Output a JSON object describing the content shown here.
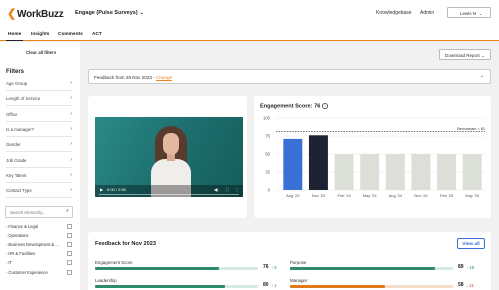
{
  "header": {
    "logo_text": "WorkBuzz",
    "product": "Engage (Pulse Surveys)",
    "links": [
      "Knowledgebase",
      "Admin"
    ],
    "user": "Lewis N"
  },
  "tabs": [
    "Home",
    "Insights",
    "Comments",
    "ACT"
  ],
  "active_tab": "Home",
  "accent_color": "#e8841a",
  "sidebar": {
    "clear_label": "Clear all filters",
    "title": "Filters",
    "filters": [
      "Age Group",
      "Length of Service",
      "Office",
      "Is a manager?",
      "Gender",
      "Job Grade",
      "Key Talent",
      "Contact Type"
    ],
    "search_placeholder": "Search Hierarchy...",
    "hierarchy": [
      "Finance & Legal",
      "Operations",
      "Business Development & ...",
      "HR & Facilities",
      "IT",
      "Customer Experience"
    ]
  },
  "toolbar": {
    "report_label": "Download Report"
  },
  "period": {
    "text": "Feedback from 26 Nov 2023 - ",
    "change_label": "Change"
  },
  "video": {
    "time": "0:00 / 2:50"
  },
  "engagement": {
    "title": "Engagement Score: 76",
    "info_icon": "i",
    "benchmark_label": "Benchmark = 81"
  },
  "chart_data": {
    "type": "bar",
    "categories": [
      "Aug '23",
      "Nov '23",
      "Feb '24",
      "May '24",
      "Aug '24",
      "Nov '24",
      "Feb '25",
      "May '25"
    ],
    "values": [
      71,
      76,
      50,
      50,
      50,
      50,
      50,
      50
    ],
    "bar_colors": [
      "#3a6fd8",
      "#1d2333",
      "#dcdfd8",
      "#dcdfd8",
      "#dcdfd8",
      "#dcdfd8",
      "#dcdfd8",
      "#dcdfd8"
    ],
    "benchmark": 81,
    "ylim": [
      0,
      100
    ],
    "yticks": [
      0,
      25,
      50,
      75,
      100
    ],
    "title": "Engagement Score: 76",
    "xlabel": "",
    "ylabel": ""
  },
  "feedback": {
    "title": "Feedback for Nov 2023",
    "view_all": "View all",
    "metrics": [
      {
        "label": "Engagement Score",
        "value": "76",
        "delta": "↑ 5",
        "delta_dir": "up",
        "fill": 0.76,
        "color": "#2e8b6e"
      },
      {
        "label": "Purpose",
        "value": "89",
        "delta": "↑ 19",
        "delta_dir": "up",
        "fill": 0.89,
        "color": "#2e8b6e"
      },
      {
        "label": "Leadership",
        "value": "80",
        "delta": "↑ 1",
        "delta_dir": "up",
        "fill": 0.8,
        "color": "#2e8b6e"
      },
      {
        "label": "Manager",
        "value": "58",
        "delta": "↓ 21",
        "delta_dir": "down",
        "fill": 0.58,
        "color": "#e07a1a"
      }
    ]
  }
}
